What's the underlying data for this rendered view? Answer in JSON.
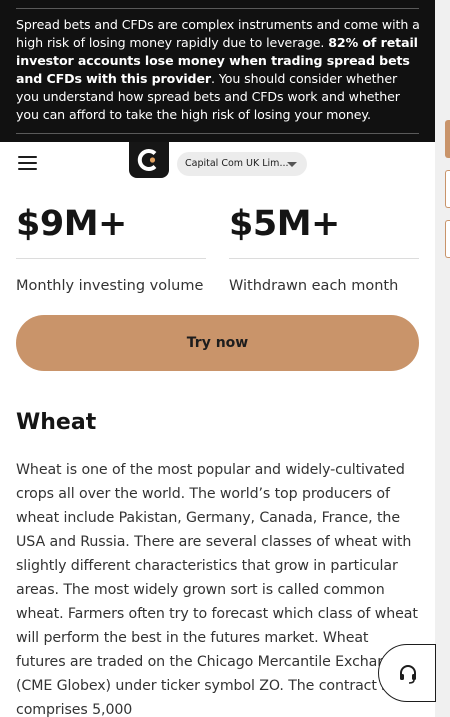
{
  "risk_warning": {
    "intro": "Spread bets and CFDs are complex instruments and come with a high risk of losing money rapidly due to leverage. ",
    "bold": "82% of retail investor accounts lose money when trading spread bets and CFDs with this provider",
    "outro": ". You should consider whether you understand how spread bets and CFDs work and whether you can afford to take the high risk of losing your money."
  },
  "header": {
    "menu_icon": "hamburger-menu-icon",
    "logo_icon": "capital-com-logo",
    "entity_select": "Capital Com UK Lim..."
  },
  "stats": [
    {
      "value": "$9M+",
      "label": "Monthly investing volume"
    },
    {
      "value": "$5M+",
      "label": "Withdrawn each month"
    }
  ],
  "cta": {
    "label": "Try now"
  },
  "article": {
    "heading": "Wheat",
    "body": "Wheat is one of the most popular and widely-cultivated crops all over the world. The world’s top producers of wheat include Pakistan, Germany, Canada, France, the USA and Russia. There are several classes of wheat with slightly different characteristics that grow in particular areas. The most widely grown sort is called common wheat. Farmers often try to forecast which class of wheat will perform the best in the futures market. Wheat futures are traded on the Chicago Mercantile Exchange (CME Globex) under ticker symbol ZO. The contract size comprises 5,000"
  },
  "support": {
    "icon": "headset-support-icon"
  },
  "colors": {
    "accent": "#c9946a",
    "banner_bg": "#111111",
    "text": "#1d1d1d"
  }
}
